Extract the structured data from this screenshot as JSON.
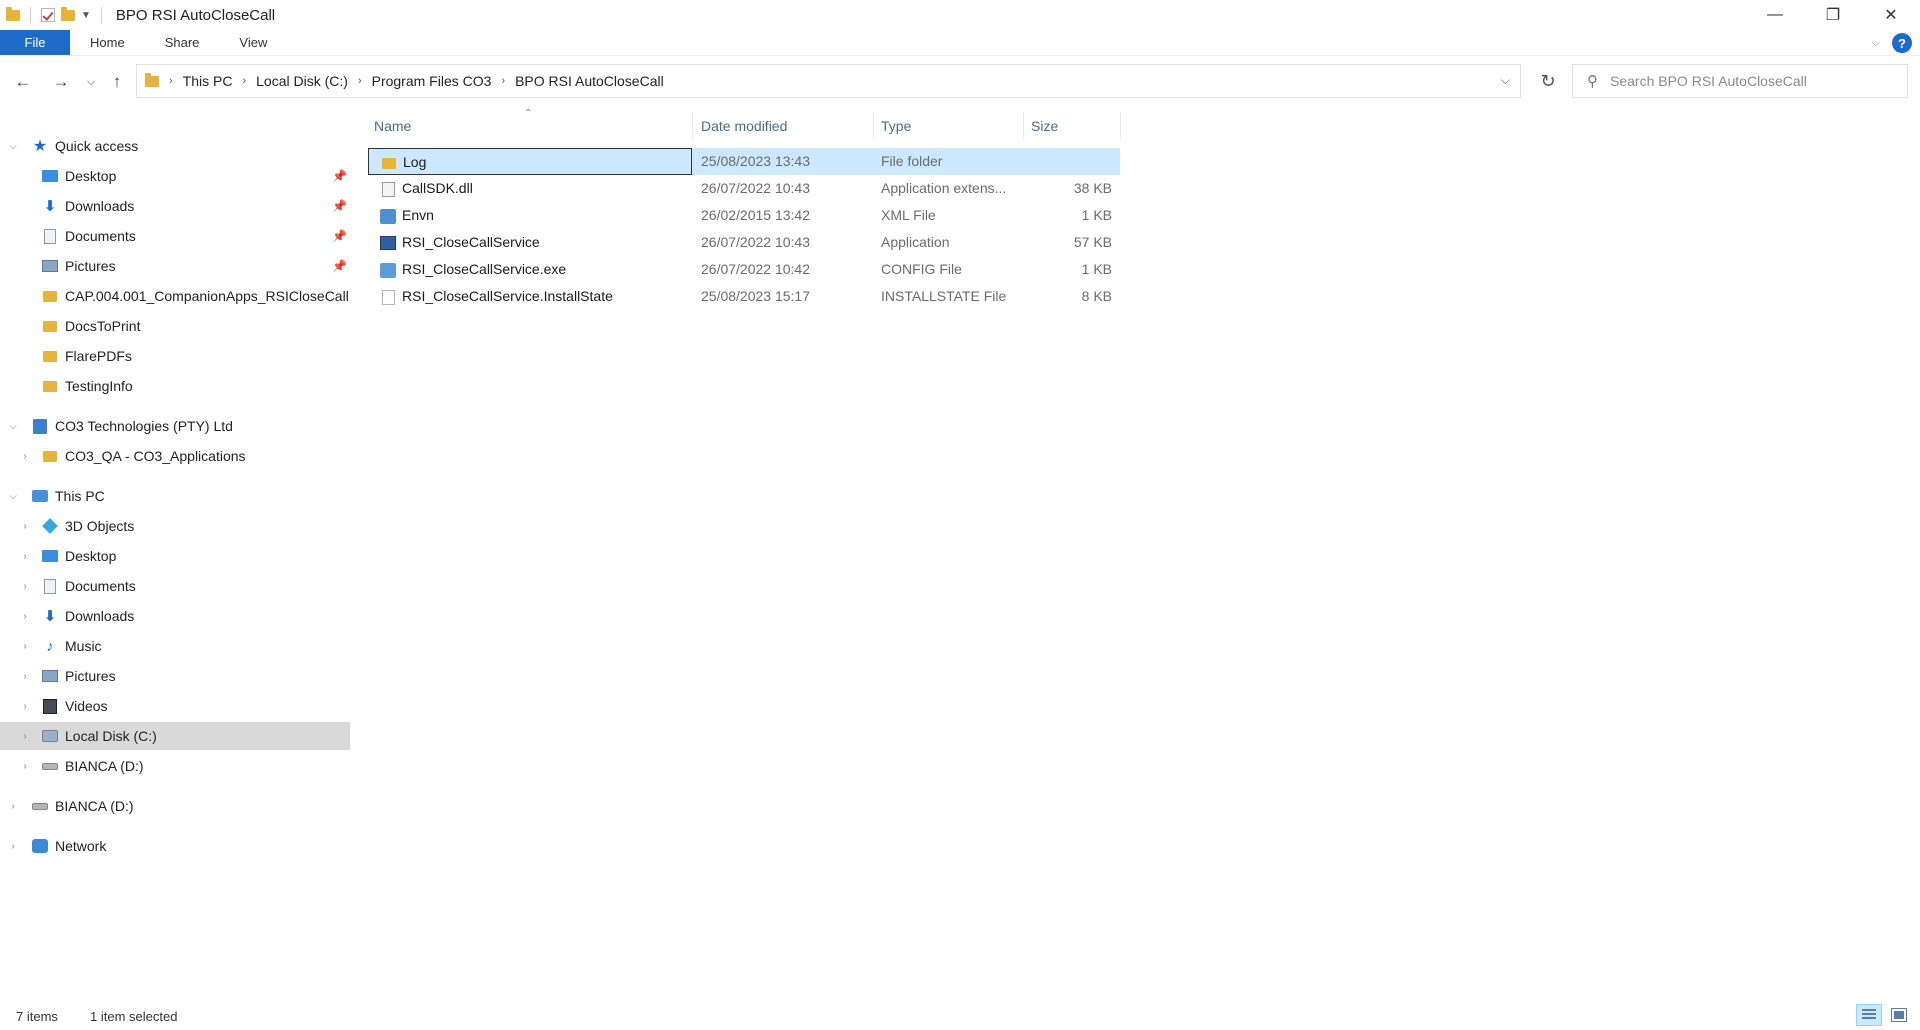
{
  "window": {
    "title": "BPO RSI AutoCloseCall",
    "minimize": "—",
    "maximize": "❐",
    "close": "✕"
  },
  "ribbon": {
    "tabs": [
      "File",
      "Home",
      "Share",
      "View"
    ],
    "help": "?"
  },
  "address": {
    "crumbs": [
      "This PC",
      "Local Disk (C:)",
      "Program Files CO3",
      "BPO RSI AutoCloseCall"
    ],
    "search_placeholder": "Search BPO RSI AutoCloseCall"
  },
  "nav": {
    "quick_access": "Quick access",
    "quick_items": [
      "Desktop",
      "Downloads",
      "Documents",
      "Pictures",
      "CAP.004.001_CompanionApps_RSICloseCall",
      "DocsToPrint",
      "FlarePDFs",
      "TestingInfo"
    ],
    "company": "CO3 Technologies (PTY) Ltd",
    "company_items": [
      "CO3_QA - CO3_Applications"
    ],
    "this_pc": "This PC",
    "pc_items": [
      "3D Objects",
      "Desktop",
      "Documents",
      "Downloads",
      "Music",
      "Pictures",
      "Videos",
      "Local Disk (C:)",
      "BIANCA (D:)"
    ],
    "drive": "BIANCA (D:)",
    "network": "Network"
  },
  "columns": {
    "name": "Name",
    "date": "Date modified",
    "type": "Type",
    "size": "Size"
  },
  "files": [
    {
      "name": "Log",
      "date": "25/08/2023 13:43",
      "type": "File folder",
      "size": "",
      "icon": "folder-icon"
    },
    {
      "name": "CallSDK.dll",
      "date": "26/07/2022 10:43",
      "type": "Application extens...",
      "size": "38 KB",
      "icon": "dll-file-icon"
    },
    {
      "name": "Envn",
      "date": "26/02/2015 13:42",
      "type": "XML File",
      "size": "1 KB",
      "icon": "xml-file-icon"
    },
    {
      "name": "RSI_CloseCallService",
      "date": "26/07/2022 10:43",
      "type": "Application",
      "size": "57 KB",
      "icon": "application-icon"
    },
    {
      "name": "RSI_CloseCallService.exe",
      "date": "26/07/2022 10:42",
      "type": "CONFIG File",
      "size": "1 KB",
      "icon": "config-file-icon"
    },
    {
      "name": "RSI_CloseCallService.InstallState",
      "date": "25/08/2023 15:17",
      "type": "INSTALLSTATE File",
      "size": "8 KB",
      "icon": "blank-file-icon"
    }
  ],
  "status": {
    "items": "7 items",
    "selected": "1 item selected"
  },
  "colors": {
    "accent": "#1e6ac8",
    "selection": "#cce8ff",
    "nav_selected": "#d9d9d9",
    "folder": "#e6b43c"
  }
}
